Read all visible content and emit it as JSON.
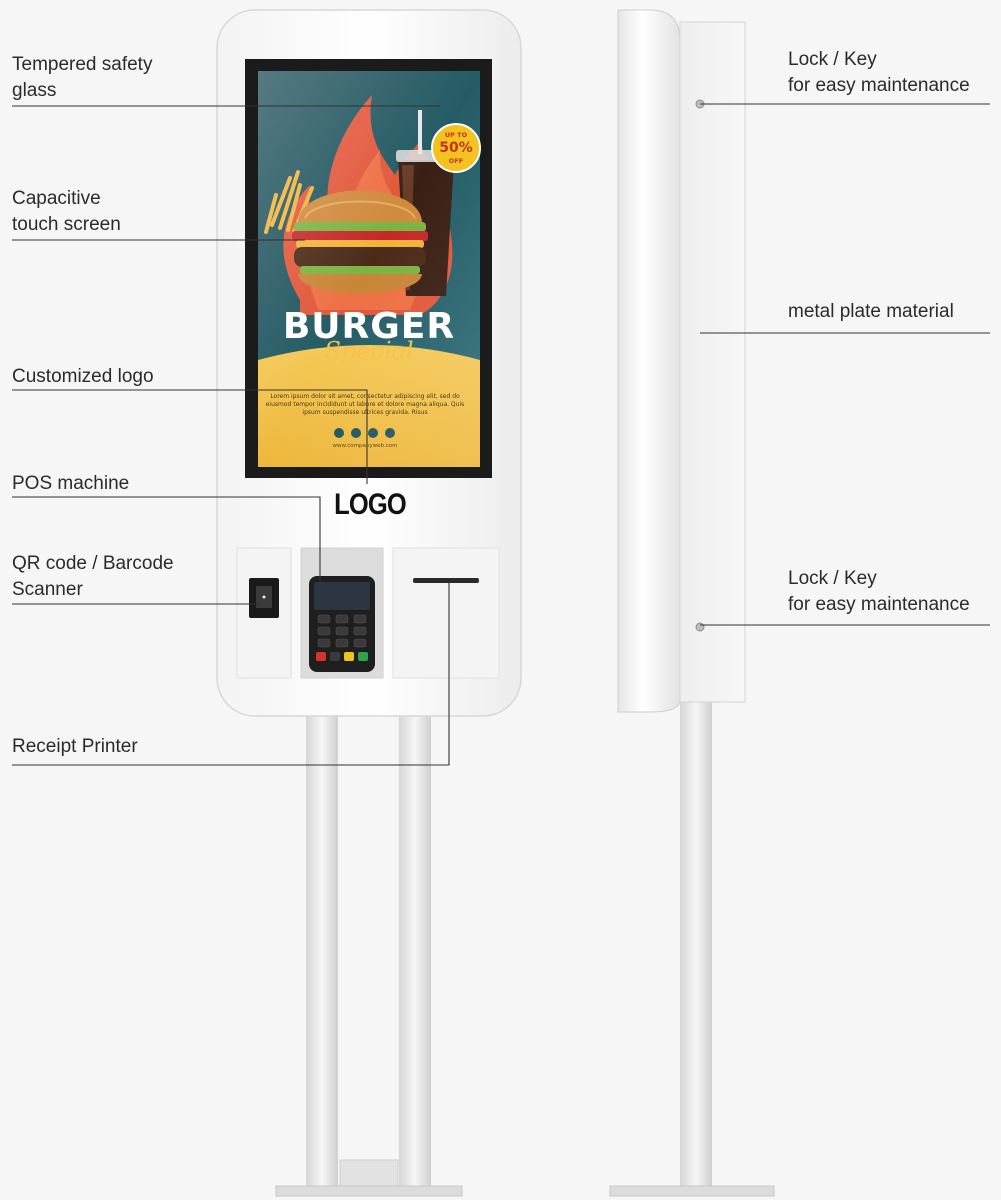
{
  "annotations": {
    "tempered_glass": "Tempered safety\nglass",
    "touch_screen": "Capacitive\ntouch screen",
    "custom_logo": "Customized logo",
    "pos_machine": "POS machine",
    "scanner": "QR code / Barcode\nScanner",
    "receipt_printer": "Receipt Printer",
    "lock_key_top": "Lock / Key\nfor easy maintenance",
    "metal_plate": "metal plate material",
    "lock_key_bottom": "Lock / Key\nfor easy maintenance"
  },
  "kiosk": {
    "logo_text": "LOGO"
  },
  "promo": {
    "badge_top": "UP TO",
    "badge_value": "50%",
    "badge_bottom": "OFF",
    "title": "BURGER",
    "subtitle": "Special",
    "body": "Lorem ipsum dolor sit amet, consectetur adipiscing elit, sed do eiusmod tempor incididunt ut labore et dolore magna aliqua. Quis ipsum suspendisse ultrices gravida. Risus",
    "website": "www.companyweb.com"
  },
  "colors": {
    "background": "#f6f6f6",
    "kiosk_body": "#ffffff",
    "screen_bezel": "#1b1b1b",
    "promo_teal": "#1f5560",
    "promo_yellow": "#f2c24d",
    "promo_flame": "#e2573a",
    "leader_line": "#333333"
  }
}
